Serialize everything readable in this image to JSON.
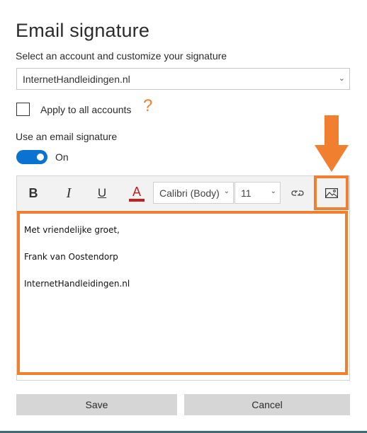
{
  "page": {
    "title": "Email signature",
    "subtitle": "Select an account and customize your signature"
  },
  "account_select": {
    "value": "InternetHandleidingen.nl",
    "chevron": "chevron-down-icon"
  },
  "apply_all": {
    "label": "Apply to all accounts",
    "checked": false,
    "help_glyph": "?"
  },
  "use_signature": {
    "label": "Use an email signature",
    "toggle_state": "On",
    "enabled": true
  },
  "toolbar": {
    "bold": "B",
    "italic": "I",
    "underline": "U",
    "font_color": "A",
    "font_family": "Calibri (Body)",
    "font_size": "11",
    "link_icon": "link-icon",
    "image_icon": "insert-image-icon"
  },
  "signature_body": {
    "lines": [
      "Met vriendelijke groet,",
      "Frank van Oostendorp",
      "InternetHandleidingen.nl"
    ]
  },
  "buttons": {
    "save": "Save",
    "cancel": "Cancel"
  },
  "colors": {
    "accent_blue": "#0a72d1",
    "highlight_orange": "#f08030",
    "font_color_red": "#c42020"
  }
}
